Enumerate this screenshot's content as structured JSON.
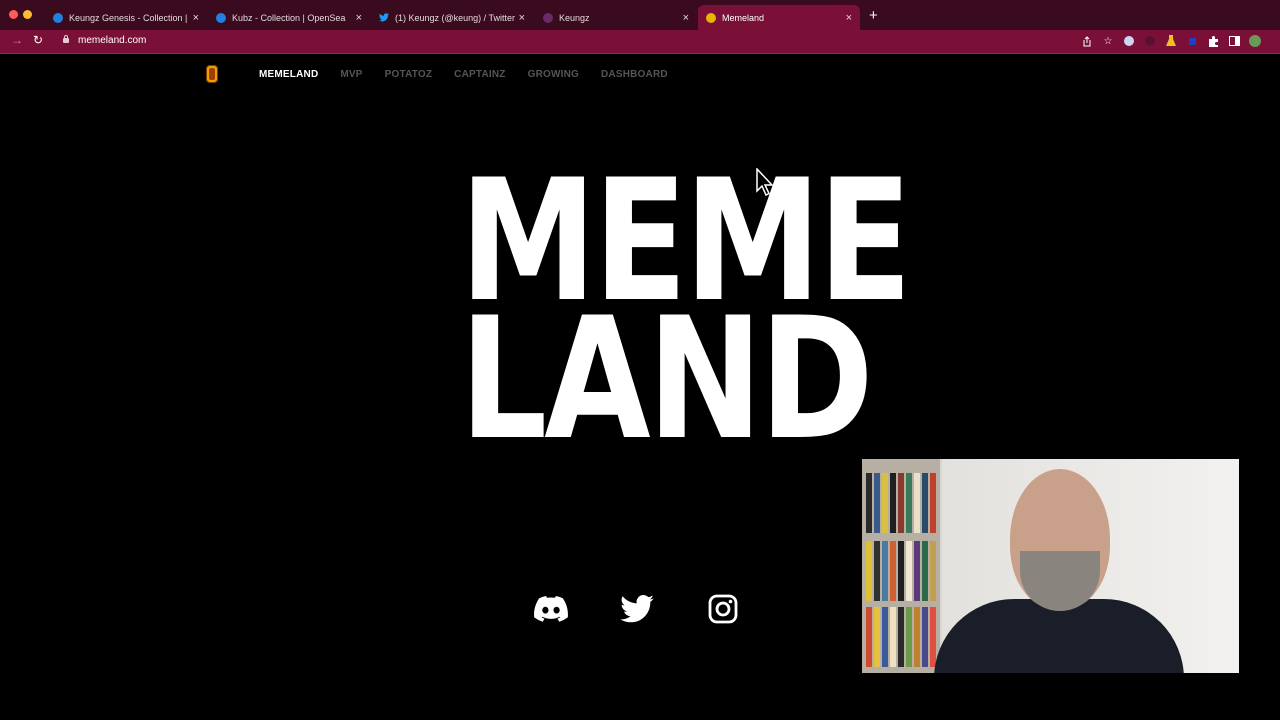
{
  "browser": {
    "tabs": [
      {
        "title": "Keungz Genesis - Collection |",
        "icon": "opensea-icon",
        "active": false
      },
      {
        "title": "Kubz - Collection | OpenSea",
        "icon": "opensea-icon",
        "active": false
      },
      {
        "title": "(1) Keungz (@keung) / Twitter",
        "icon": "twitter-icon",
        "active": false
      },
      {
        "title": "Keungz",
        "icon": "keungz-icon",
        "active": false
      },
      {
        "title": "Memeland",
        "icon": "memeland-icon",
        "active": true
      }
    ],
    "new_tab": "+",
    "close_glyph": "×",
    "url": "memeland.com",
    "colors": {
      "frame": "#3a0a1f",
      "toolbar": "#7a1038"
    }
  },
  "site": {
    "nav": [
      {
        "label": "MEMELAND",
        "active": true
      },
      {
        "label": "MVP",
        "active": false
      },
      {
        "label": "POTATOZ",
        "active": false
      },
      {
        "label": "CAPTAINZ",
        "active": false
      },
      {
        "label": "GROWING",
        "active": false
      },
      {
        "label": "DASHBOARD",
        "active": false
      }
    ],
    "hero": {
      "line1": "MEME",
      "line2": "LAND"
    },
    "socials": [
      "discord-icon",
      "twitter-icon",
      "instagram-icon"
    ]
  }
}
